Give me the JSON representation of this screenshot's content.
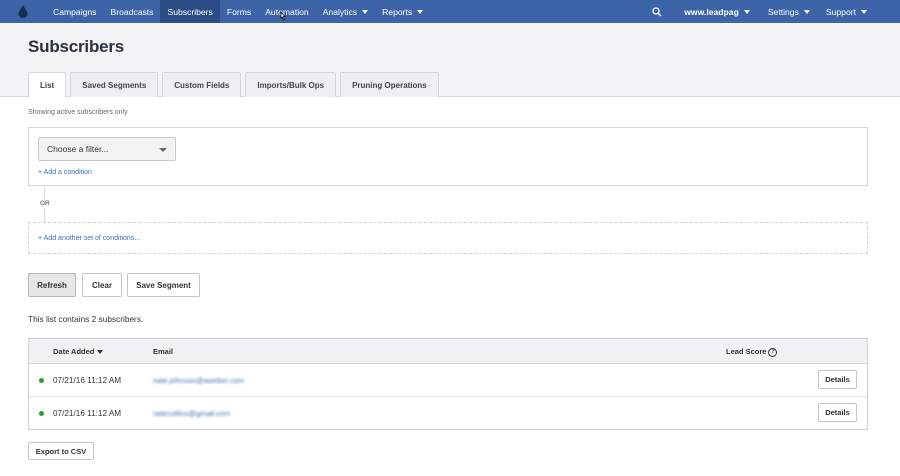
{
  "nav": {
    "items": [
      {
        "label": "Campaigns",
        "active": false,
        "dropdown": false
      },
      {
        "label": "Broadcasts",
        "active": false,
        "dropdown": false
      },
      {
        "label": "Subscribers",
        "active": true,
        "dropdown": false
      },
      {
        "label": "Forms",
        "active": false,
        "dropdown": false
      },
      {
        "label": "Automation",
        "active": false,
        "dropdown": false
      },
      {
        "label": "Analytics",
        "active": false,
        "dropdown": true
      },
      {
        "label": "Reports",
        "active": false,
        "dropdown": true
      }
    ],
    "account": "www.leadpag",
    "settings": "Settings",
    "support": "Support"
  },
  "page": {
    "title": "Subscribers",
    "tabs": [
      "List",
      "Saved Segments",
      "Custom Fields",
      "Imports/Bulk Ops",
      "Pruning Operations"
    ],
    "active_tab": "List"
  },
  "filter": {
    "showing": "Showing active subscribers only",
    "select_placeholder": "Choose a filter...",
    "add_condition": "+ Add a condition",
    "or_label": "OR",
    "add_set": "+ Add another set of conditions..."
  },
  "actions": {
    "refresh": "Refresh",
    "clear": "Clear",
    "save_segment": "Save Segment"
  },
  "summary": "This list contains 2 subscribers.",
  "table": {
    "columns": {
      "date": "Date Added",
      "email": "Email",
      "lead_score": "Lead Score"
    },
    "rows": [
      {
        "date": "07/21/16 11:12 AM",
        "email": "nate.johnson@aweber.com",
        "details": "Details"
      },
      {
        "date": "07/21/16 11:12 AM",
        "email": "natecollins@gmail.com",
        "details": "Details"
      }
    ]
  },
  "export": "Export to CSV",
  "colors": {
    "nav_bg": "#3d64a8",
    "nav_active": "#2b4c85",
    "link": "#3a6fbb",
    "status_dot": "#2e9b3a"
  }
}
